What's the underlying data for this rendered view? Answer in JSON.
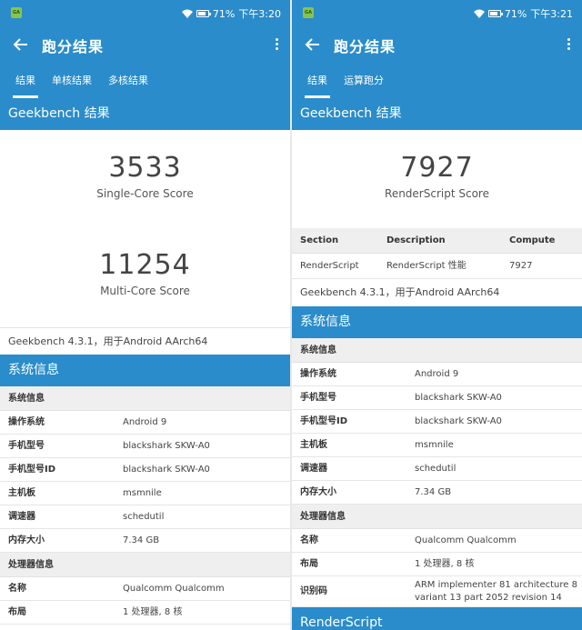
{
  "left": {
    "status": {
      "battery": "71%",
      "time": "下午3:20"
    },
    "appbar": {
      "title": "跑分结果"
    },
    "tabs": [
      "结果",
      "单核结果",
      "多核结果"
    ],
    "section_title": "Geekbench 结果",
    "single_score": "3533",
    "single_label": "Single-Core Score",
    "multi_score": "11254",
    "multi_label": "Multi-Core Score",
    "version_note": "Geekbench 4.3.1，用于Android AArch64",
    "sysinfo_header": "系统信息",
    "sys_subhead": "系统信息",
    "sys_rows": [
      {
        "k": "操作系统",
        "v": "Android 9"
      },
      {
        "k": "手机型号",
        "v": "blackshark SKW-A0"
      },
      {
        "k": "手机型号ID",
        "v": "blackshark SKW-A0"
      },
      {
        "k": "主机板",
        "v": "msmnile"
      },
      {
        "k": "调速器",
        "v": "schedutil"
      },
      {
        "k": "内存大小",
        "v": "7.34 GB"
      }
    ],
    "cpu_subhead": "处理器信息",
    "cpu_rows": [
      {
        "k": "名称",
        "v": "Qualcomm Qualcomm"
      },
      {
        "k": "布局",
        "v": "1 处理器, 8 核"
      }
    ]
  },
  "right": {
    "status": {
      "battery": "71%",
      "time": "下午3:21"
    },
    "appbar": {
      "title": "跑分结果"
    },
    "tabs": [
      "结果",
      "运算跑分"
    ],
    "section_title": "Geekbench 结果",
    "score": "7927",
    "score_label": "RenderScript Score",
    "table_head": {
      "section": "Section",
      "description": "Description",
      "compute": "Compute"
    },
    "table_row": {
      "section": "RenderScript",
      "description": "RenderScript 性能",
      "compute": "7927"
    },
    "version_note": "Geekbench 4.3.1，用于Android AArch64",
    "sysinfo_header": "系统信息",
    "sys_subhead": "系统信息",
    "sys_rows": [
      {
        "k": "操作系统",
        "v": "Android 9"
      },
      {
        "k": "手机型号",
        "v": "blackshark SKW-A0"
      },
      {
        "k": "手机型号ID",
        "v": "blackshark SKW-A0"
      },
      {
        "k": "主机板",
        "v": "msmnile"
      },
      {
        "k": "调速器",
        "v": "schedutil"
      },
      {
        "k": "内存大小",
        "v": "7.34 GB"
      }
    ],
    "cpu_subhead": "处理器信息",
    "cpu_rows": [
      {
        "k": "名称",
        "v": "Qualcomm Qualcomm"
      },
      {
        "k": "布局",
        "v": "1 处理器, 8 核"
      }
    ],
    "id_row": {
      "k": "识别码",
      "v": "ARM implementer 81 architecture 8 variant 13 part 2052 revision 14"
    },
    "bottom_header": "RenderScript"
  },
  "colors": {
    "primary": "#2a8ccb",
    "subhead_bg": "#efefef"
  }
}
